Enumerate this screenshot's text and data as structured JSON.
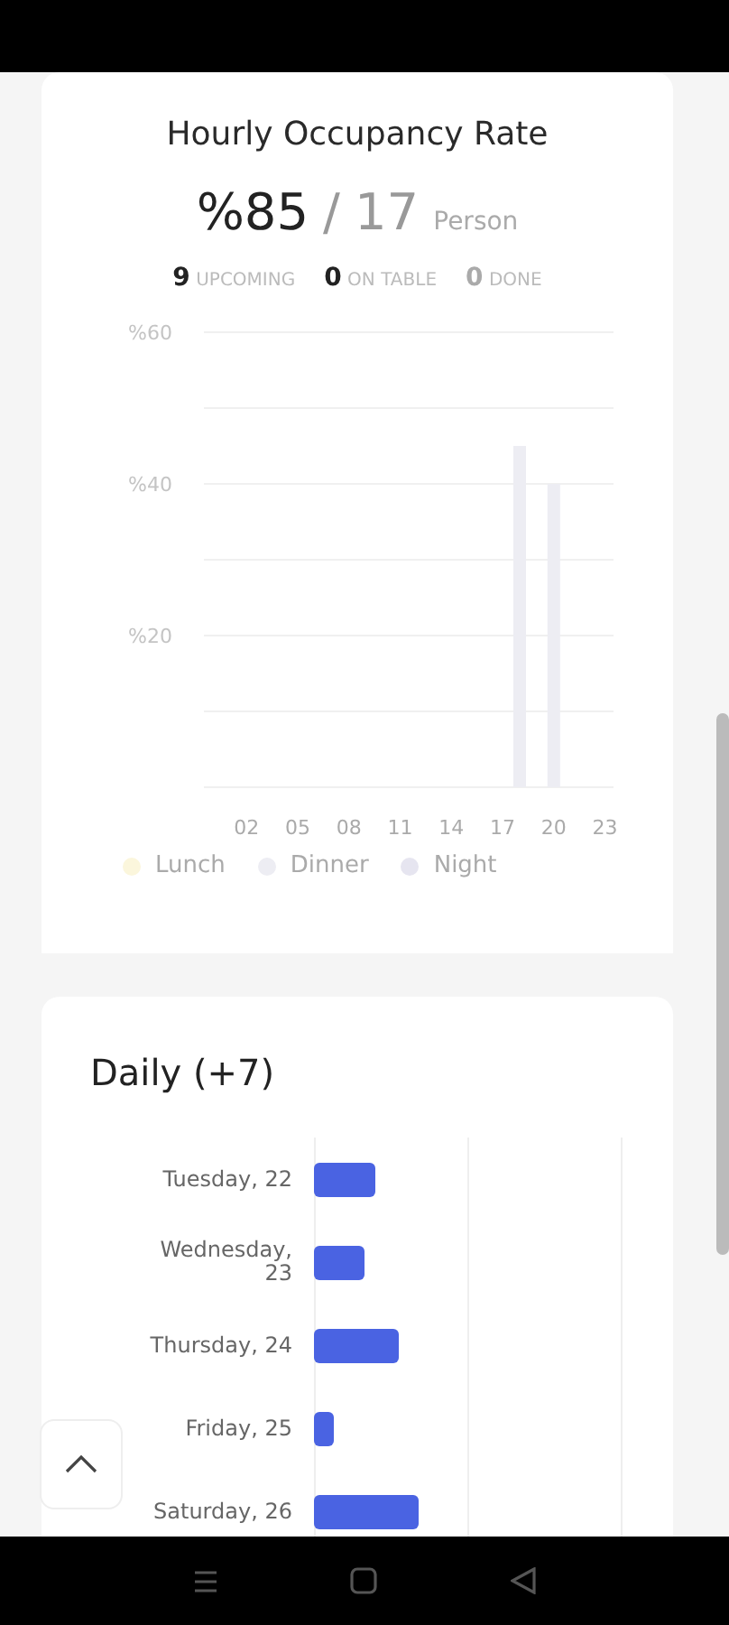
{
  "occupancy": {
    "title": "Hourly Occupancy Rate",
    "rate": "%85",
    "separator": "/",
    "count": "17",
    "unit": "Person",
    "stats": [
      {
        "text": "**9** UPCOMING",
        "emphasis": true
      },
      {
        "text": "**0** ON TABLE",
        "emphasis": true
      },
      {
        "text": "**0** DONE",
        "emphasis": false
      }
    ],
    "chart_data": {
      "type": "bar",
      "stacked": true,
      "x": [
        18,
        20
      ],
      "xlim": [
        -0.5,
        23.5
      ],
      "xticks": [
        {
          "value": 2,
          "label": "02"
        },
        {
          "value": 5,
          "label": "05"
        },
        {
          "value": 8,
          "label": "08"
        },
        {
          "value": 11,
          "label": "11"
        },
        {
          "value": 14,
          "label": "14"
        },
        {
          "value": 17,
          "label": "17"
        },
        {
          "value": 20,
          "label": "20"
        },
        {
          "value": 23,
          "label": "23"
        }
      ],
      "ylim": [
        0,
        60
      ],
      "yticks": [
        {
          "value": 20,
          "label": "%20"
        },
        {
          "value": 40,
          "label": "%40"
        },
        {
          "value": 60,
          "label": "%60"
        }
      ],
      "series": [
        {
          "name": "Lunch",
          "color": "#fbf6dc",
          "values": [
            null,
            null
          ]
        },
        {
          "name": "Dinner",
          "color": "#ededf3",
          "values": [
            45,
            40
          ]
        },
        {
          "name": "Night",
          "color": "#e6e5f0",
          "values": [
            null,
            null
          ]
        }
      ]
    }
  },
  "daily": {
    "title": "Daily (+7)",
    "days": [
      {
        "label": "Tuesday, 22"
      },
      {
        "label": "Wednesday, 23"
      },
      {
        "label": "Thursday, 24"
      },
      {
        "label": "Friday, 25"
      },
      {
        "label": "Saturday, 26"
      }
    ]
  }
}
